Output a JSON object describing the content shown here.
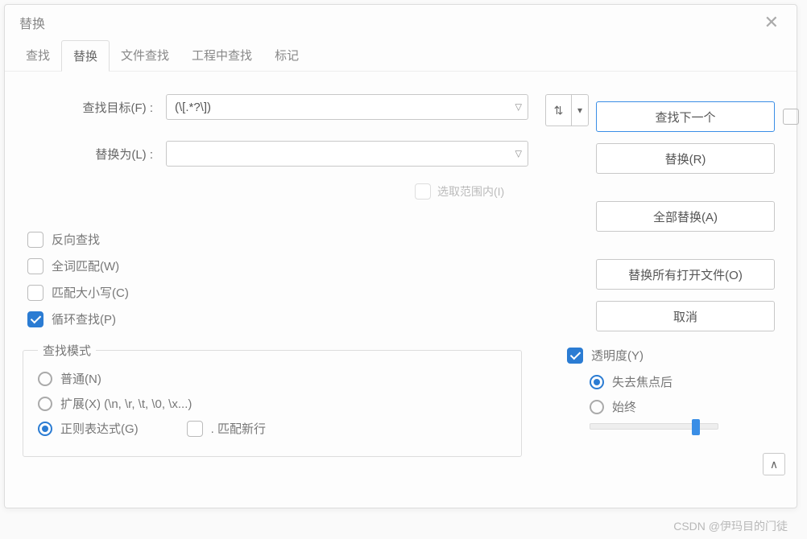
{
  "title": "替换",
  "tabs": {
    "find": "查找",
    "replace": "替换",
    "findInFiles": "文件查找",
    "findInProject": "工程中查找",
    "mark": "标记"
  },
  "labels": {
    "findWhat": "查找目标(F) :",
    "replaceWith": "替换为(L) :",
    "inSelection": "选取范围内(I)"
  },
  "fields": {
    "findValue": "(\\[.*?\\])",
    "replaceValue": ""
  },
  "buttons": {
    "findNext": "查找下一个",
    "replace": "替换(R)",
    "replaceAll": "全部替换(A)",
    "replaceAllOpen": "替换所有打开文件(O)",
    "cancel": "取消"
  },
  "options": {
    "backward": "反向查找",
    "wholeWord": "全词匹配(W)",
    "matchCase": "匹配大小写(C)",
    "wrap": "循环查找(P)"
  },
  "searchMode": {
    "legend": "查找模式",
    "normal": "普通(N)",
    "extended": "扩展(X) (\\n, \\r, \\t, \\0, \\x...)",
    "regex": "正则表达式(G)",
    "dotNewline": ". 匹配新行"
  },
  "transparency": {
    "label": "透明度(Y)",
    "onLoseFocus": "失去焦点后",
    "always": "始终"
  },
  "watermark": "CSDN @伊玛目的门徒"
}
